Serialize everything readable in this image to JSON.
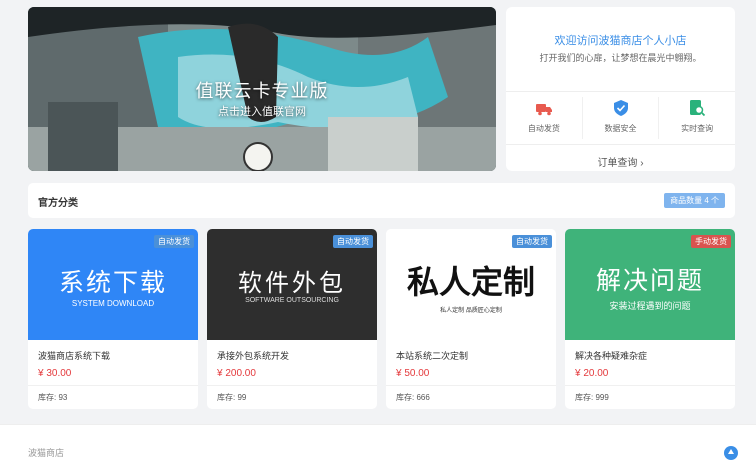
{
  "banner": {
    "title": "值联云卡专业版",
    "subtitle": "点击进入值联官网"
  },
  "shop": {
    "welcome": "欢迎访问波猫商店个人小店",
    "motto": "打开我们的心扉，让梦想在晨光中翱翔。",
    "features": [
      {
        "label": "自动发货",
        "icon": "truck-icon",
        "color": "#e85a4f"
      },
      {
        "label": "数据安全",
        "icon": "shield-icon",
        "color": "#3a8ee6"
      },
      {
        "label": "实时查询",
        "icon": "search-doc-icon",
        "color": "#2ab27b"
      }
    ],
    "order_query": "订单查询 ›"
  },
  "category": {
    "title": "官方分类",
    "count_badge": "商品数量 4 个"
  },
  "products": [
    {
      "name": "波猫商店系统下载",
      "price": "¥ 30.00",
      "stock": "库存: 93",
      "tag": "自动发货",
      "thumb_main": "系统下载",
      "thumb_sub": "SYSTEM DOWNLOAD",
      "thumb_bg": "#2f86f6"
    },
    {
      "name": "承接外包系统开发",
      "price": "¥ 200.00",
      "stock": "库存: 99",
      "tag": "自动发货",
      "thumb_main": "软件外包",
      "thumb_sub": "SOFTWARE OUTSOURCING",
      "thumb_bg": "#2e2e2e"
    },
    {
      "name": "本站系统二次定制",
      "price": "¥ 50.00",
      "stock": "库存: 666",
      "tag": "自动发货",
      "thumb_main": "私人定制",
      "thumb_sub": "私人定制  品质匠心定制",
      "thumb_bg": "#ffffff"
    },
    {
      "name": "解决各种疑难杂症",
      "price": "¥ 20.00",
      "stock": "库存: 999",
      "tag": "手动发货",
      "thumb_main": "解决问题",
      "thumb_sub": "安装过程遇到的问题",
      "thumb_bg": "#3fb37a"
    }
  ],
  "footer": {
    "text": "波猫商店"
  }
}
